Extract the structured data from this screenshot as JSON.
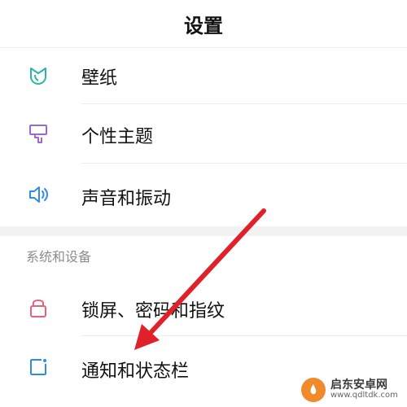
{
  "header": {
    "title": "设置"
  },
  "items_top": [
    {
      "label": "壁纸",
      "icon": "wallpaper-icon"
    },
    {
      "label": "个性主题",
      "icon": "theme-brush-icon"
    },
    {
      "label": "声音和振动",
      "icon": "speaker-icon"
    }
  ],
  "section": {
    "title": "系统和设备",
    "items": [
      {
        "label": "锁屏、密码和指纹",
        "icon": "lock-icon"
      },
      {
        "label": "通知和状态栏",
        "icon": "notification-icon"
      }
    ]
  },
  "colors": {
    "wallpaper_icon": "#2bb5a3",
    "theme_icon": "#9a6ad0",
    "speaker_icon": "#2f8be8",
    "lock_icon": "#e8607a",
    "notification_icon": "#2f8be8",
    "arrow": "#e0212a"
  },
  "watermark": {
    "name": "启东安卓网",
    "url": "www.qdltdk.com"
  }
}
